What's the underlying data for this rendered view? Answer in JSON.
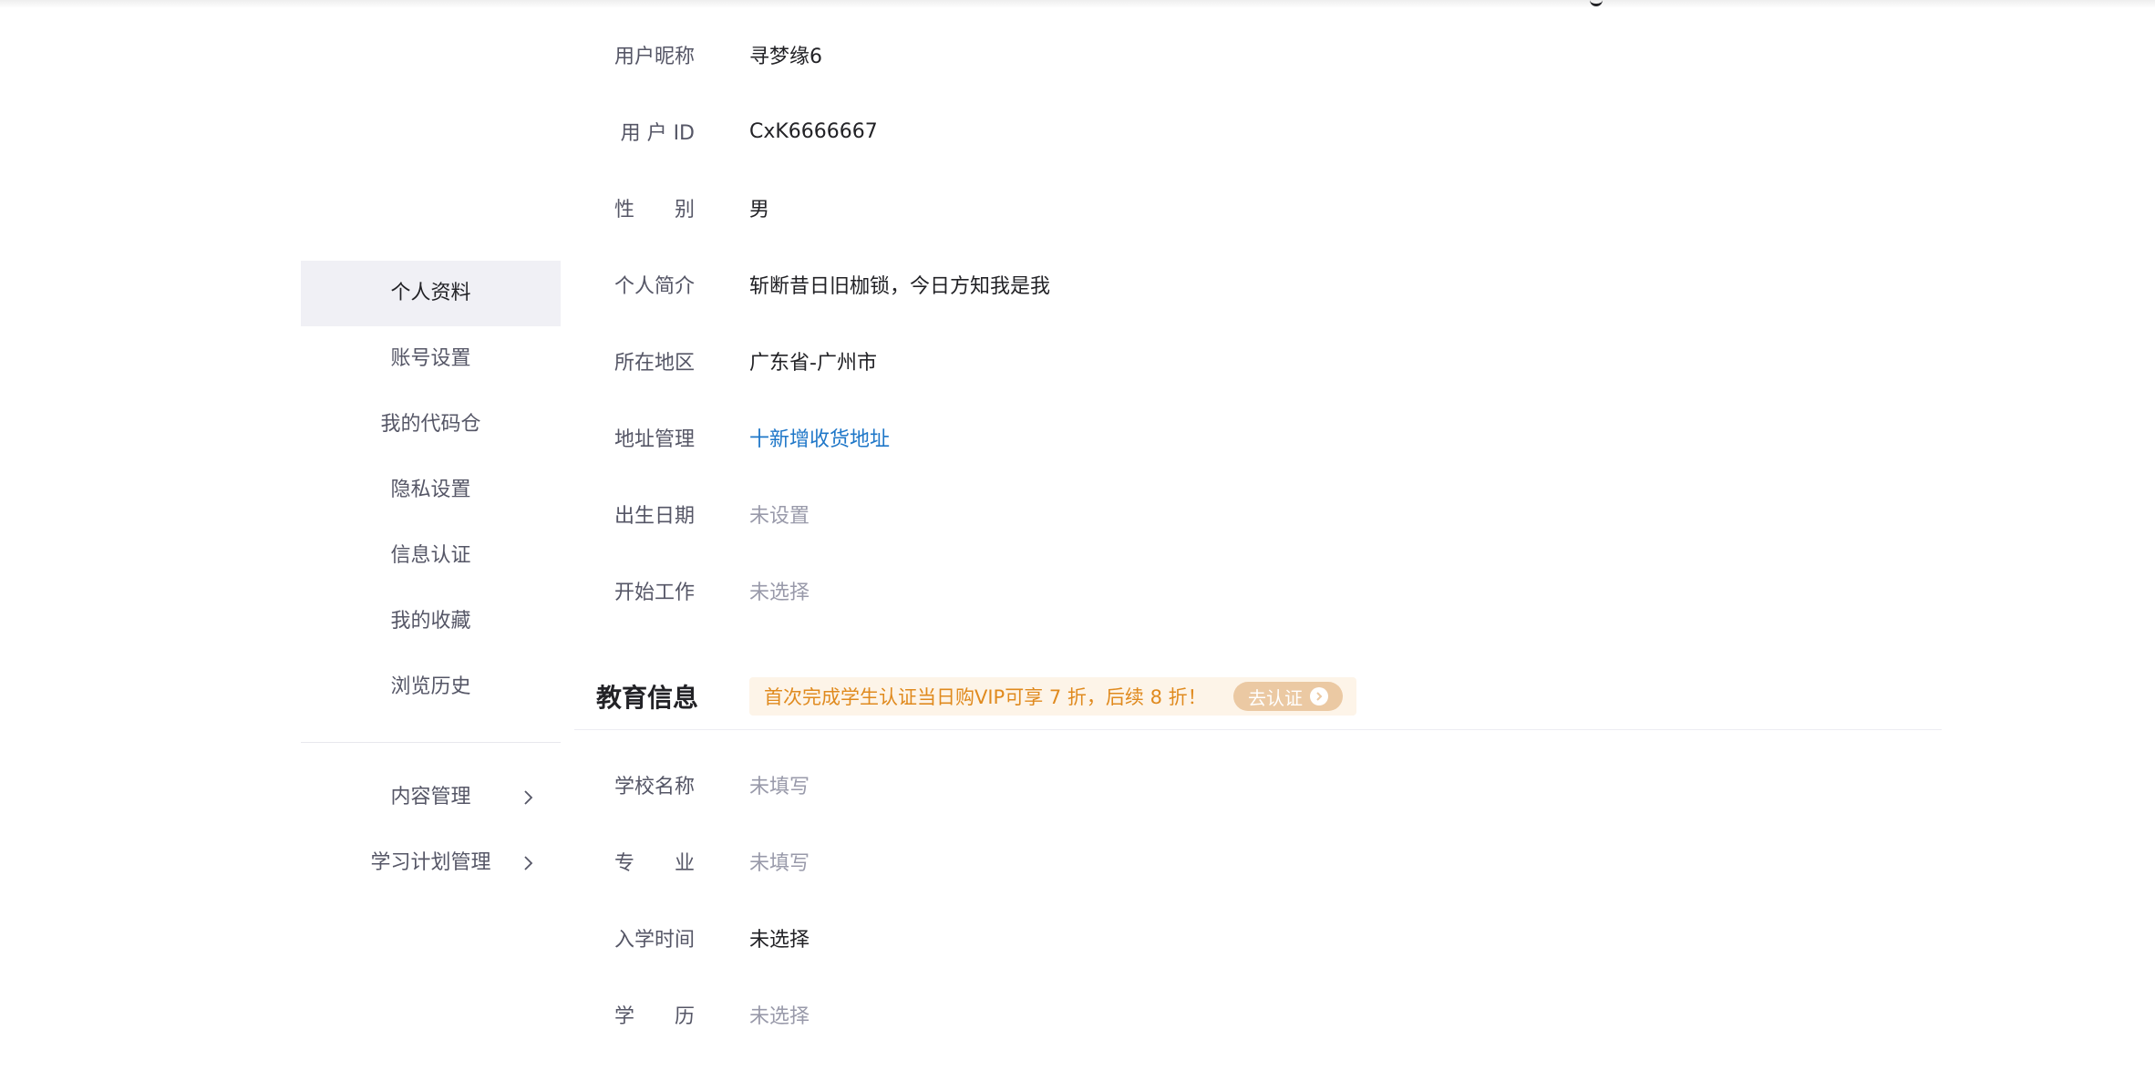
{
  "sidebar": {
    "items": [
      {
        "label": "个人资料"
      },
      {
        "label": "账号设置"
      },
      {
        "label": "我的代码仓"
      },
      {
        "label": "隐私设置"
      },
      {
        "label": "信息认证"
      },
      {
        "label": "我的收藏"
      },
      {
        "label": "浏览历史"
      }
    ],
    "expandable": [
      {
        "label": "内容管理",
        "icon": "chevron-right-icon"
      },
      {
        "label": "学习计划管理",
        "icon": "chevron-right-icon"
      }
    ],
    "active_color": "#f0f0f5"
  },
  "profile": {
    "nickname": {
      "label": "用户昵称",
      "value": "寻梦缘6"
    },
    "user_id": {
      "label": "用 户 ID",
      "value": "CxK6666667"
    },
    "gender": {
      "label": "性　　别",
      "value": "男"
    },
    "bio": {
      "label": "个人简介",
      "value": "斩断昔日旧枷锁，今日方知我是我"
    },
    "region": {
      "label": "所在地区",
      "value": "广东省-广州市"
    },
    "address": {
      "label": "地址管理",
      "value": "十新增收货地址"
    },
    "birthday": {
      "label": "出生日期",
      "value": "未设置"
    },
    "work_start": {
      "label": "开始工作",
      "value": "未选择"
    }
  },
  "education": {
    "title": "教育信息",
    "promo_text": "首次完成学生认证当日购VIP可享 7 折，后续 8 折！",
    "promo_button": "去认证",
    "school": {
      "label": "学校名称",
      "value": "未填写"
    },
    "major": {
      "label": "专　　业",
      "value": "未填写"
    },
    "enroll_time": {
      "label": "入学时间",
      "value": "未选择"
    },
    "degree": {
      "label": "学　　历",
      "value": "未选择"
    }
  },
  "colors": {
    "link": "#1f77c8",
    "muted": "#999aaa",
    "promo_text": "#e08a1e",
    "promo_bg": "#fdf4e8",
    "promo_button_bg": "#ebc9a3"
  }
}
